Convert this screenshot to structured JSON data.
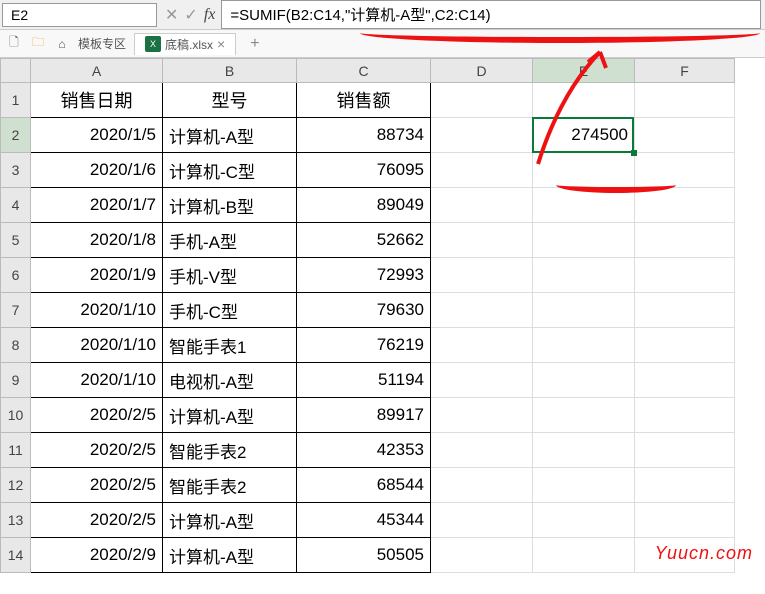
{
  "nameBox": "E2",
  "formula": "=SUMIF(B2:C14,\"计算机-A型\",C2:C14)",
  "templateArea": "模板专区",
  "tabFile": "底稿.xlsx",
  "columns": [
    "A",
    "B",
    "C",
    "D",
    "E",
    "F"
  ],
  "rowNums": [
    "1",
    "2",
    "3",
    "4",
    "5",
    "6",
    "7",
    "8",
    "9",
    "10",
    "11",
    "12",
    "13",
    "14"
  ],
  "headers": {
    "a": "销售日期",
    "b": "型号",
    "c": "销售额"
  },
  "rows": [
    {
      "a": "2020/1/5",
      "b": "计算机-A型",
      "c": "88734"
    },
    {
      "a": "2020/1/6",
      "b": "计算机-C型",
      "c": "76095"
    },
    {
      "a": "2020/1/7",
      "b": "计算机-B型",
      "c": "89049"
    },
    {
      "a": "2020/1/8",
      "b": "手机-A型",
      "c": "52662"
    },
    {
      "a": "2020/1/9",
      "b": "手机-V型",
      "c": "72993"
    },
    {
      "a": "2020/1/10",
      "b": "手机-C型",
      "c": "79630"
    },
    {
      "a": "2020/1/10",
      "b": "智能手表1",
      "c": "76219"
    },
    {
      "a": "2020/1/10",
      "b": "电视机-A型",
      "c": "51194"
    },
    {
      "a": "2020/2/5",
      "b": "计算机-A型",
      "c": "89917"
    },
    {
      "a": "2020/2/5",
      "b": "智能手表2",
      "c": "42353"
    },
    {
      "a": "2020/2/5",
      "b": "智能手表2",
      "c": "68544"
    },
    {
      "a": "2020/2/5",
      "b": "计算机-A型",
      "c": "45344"
    },
    {
      "a": "2020/2/9",
      "b": "计算机-A型",
      "c": "50505"
    }
  ],
  "e2Value": "274500",
  "watermark": "Yuucn.com"
}
